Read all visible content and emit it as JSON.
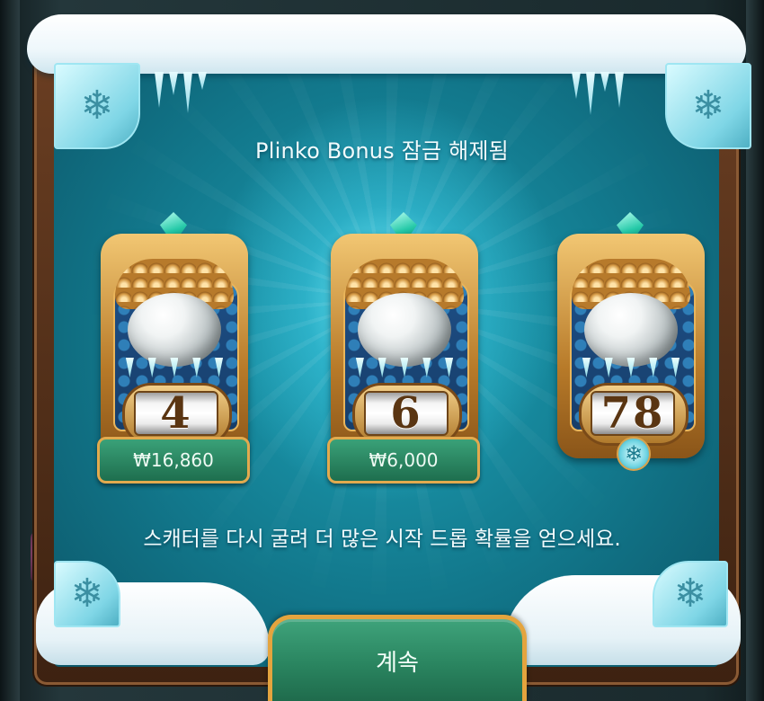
{
  "title": "Plinko Bonus 잠금 해제됨",
  "cards": [
    {
      "number": "4",
      "prize": "₩16,860"
    },
    {
      "number": "6",
      "prize": "₩6,000"
    },
    {
      "number": "78",
      "prize": ""
    }
  ],
  "message": "스캐터를 다시 굴려 더 많은 시작 드롭 확률을 얻으세요.",
  "continue_label": "계속",
  "icons": {
    "corner": "snowflake-icon",
    "gem": "gem-icon",
    "badge": "snowflake-badge-icon"
  },
  "colors": {
    "panel": "#1ea2b7",
    "gold": "#e2aa4e",
    "prize_green": "#2a8560",
    "text": "#f1fbfd"
  }
}
